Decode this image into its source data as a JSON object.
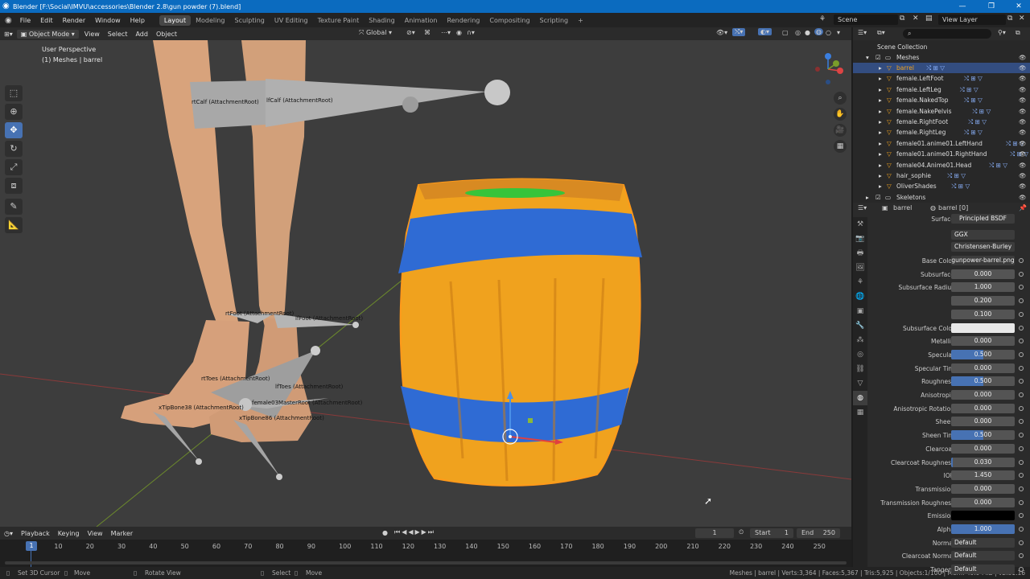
{
  "window": {
    "title": "Blender [F:\\Social\\IMVU\\accessories\\Blender 2.8\\gun powder (7).blend]"
  },
  "menu": [
    "File",
    "Edit",
    "Render",
    "Window",
    "Help"
  ],
  "workspaces": [
    "Layout",
    "Modeling",
    "Sculpting",
    "UV Editing",
    "Texture Paint",
    "Shading",
    "Animation",
    "Rendering",
    "Compositing",
    "Scripting"
  ],
  "active_workspace": "Layout",
  "scene": {
    "label": "Scene",
    "view_layer": "View Layer"
  },
  "viewport_header": {
    "mode": "Object Mode",
    "menus": [
      "View",
      "Select",
      "Add",
      "Object"
    ],
    "orientation": "Global"
  },
  "viewport_info": {
    "line1": "User Perspective",
    "line2": "(1) Meshes | barrel"
  },
  "bone_labels": {
    "rcalf": "rtCalf (AttachmentRoot)",
    "lcalf": "lfCalf (AttachmentRoot)",
    "rfoot": "rtFoot (AttachmentRoot)",
    "lfoot": "lfFoot (AttachmentRoot)",
    "rtoes": "rtToes (AttachmentRoot)",
    "ltoes": "lfToes (AttachmentRoot)",
    "master": "female03MasterRoot (AttachmentRoot)",
    "tip38": "xTipBone38 (AttachmentRoot)",
    "tip86": "xTipBone86 (AttachmentRoot)"
  },
  "outliner": {
    "scene_collection": "Scene Collection",
    "meshes": "Meshes",
    "items": [
      "barrel",
      "female.LeftFoot",
      "female.LeftLeg",
      "female.NakedTop",
      "female.NakePelvis",
      "female.RightFoot",
      "female.RightLeg",
      "female01.anime01.LeftHand",
      "female01.anime01.RightHand",
      "female04.Anime01.Head",
      "hair_sophie",
      "OliverShades"
    ],
    "skeletons": "Skeletons",
    "selected": "barrel"
  },
  "properties": {
    "breadcrumb_object": "barrel",
    "breadcrumb_material": "barrel [0]",
    "surface_label": "Surface",
    "surface_value": "Principled BSDF",
    "distribution": "GGX",
    "subsurface_method": "Christensen-Burley",
    "rows": [
      {
        "label": "Base Color",
        "value": "gunpower-barrel.png",
        "kind": "texture"
      },
      {
        "label": "Subsurface",
        "value": "0.000",
        "fill": 0
      },
      {
        "label": "Subsurface Radius",
        "value": "1.000",
        "fill": 0
      },
      {
        "label": "",
        "value": "0.200",
        "fill": 0
      },
      {
        "label": "",
        "value": "0.100",
        "fill": 0
      },
      {
        "label": "Subsurface Color",
        "value": "",
        "kind": "white"
      },
      {
        "label": "Metallic",
        "value": "0.000",
        "fill": 0
      },
      {
        "label": "Specular",
        "value": "0.500",
        "fill": 0.5
      },
      {
        "label": "Specular Tint",
        "value": "0.000",
        "fill": 0
      },
      {
        "label": "Roughness",
        "value": "0.500",
        "fill": 0.5
      },
      {
        "label": "Anisotropic",
        "value": "0.000",
        "fill": 0
      },
      {
        "label": "Anisotropic Rotation",
        "value": "0.000",
        "fill": 0
      },
      {
        "label": "Sheen",
        "value": "0.000",
        "fill": 0
      },
      {
        "label": "Sheen Tint",
        "value": "0.500",
        "fill": 0.5
      },
      {
        "label": "Clearcoat",
        "value": "0.000",
        "fill": 0
      },
      {
        "label": "Clearcoat Roughness",
        "value": "0.030",
        "fill": 0.03
      },
      {
        "label": "IOR",
        "value": "1.450",
        "fill": 0
      },
      {
        "label": "Transmission",
        "value": "0.000",
        "fill": 0
      },
      {
        "label": "Transmission Roughness",
        "value": "0.000",
        "fill": 0
      },
      {
        "label": "Emission",
        "value": "",
        "kind": "black"
      },
      {
        "label": "Alpha",
        "value": "1.000",
        "fill": 1
      },
      {
        "label": "Normal",
        "value": "Default",
        "kind": "dark"
      },
      {
        "label": "Clearcoat Normal",
        "value": "Default",
        "kind": "dark"
      },
      {
        "label": "Tangent",
        "value": "Default",
        "kind": "dark"
      }
    ]
  },
  "timeline": {
    "menus": [
      "Playback",
      "Keying",
      "View",
      "Marker"
    ],
    "current_frame": "1",
    "start_label": "Start",
    "start": "1",
    "end_label": "End",
    "end": "250",
    "ticks": [
      "10",
      "20",
      "30",
      "40",
      "50",
      "60",
      "70",
      "80",
      "90",
      "100",
      "110",
      "120",
      "130",
      "140",
      "150",
      "160",
      "170",
      "180",
      "190",
      "200",
      "210",
      "220",
      "230",
      "240",
      "250"
    ]
  },
  "status": {
    "left": [
      "Set 3D Cursor",
      "Move",
      "Rotate View",
      "Select",
      "Move"
    ],
    "right": "Meshes | barrel | Verts:3,364 | Faces:5,367 | Tris:5,925 | Objects:1/100 | Mem: 49.9 MiB | v2.81.16"
  },
  "colors": {
    "accent": "#4772b3",
    "barrel_orange": "#f0a21e",
    "barrel_band": "#2f6bd4",
    "barrel_top": "#37c43a"
  }
}
